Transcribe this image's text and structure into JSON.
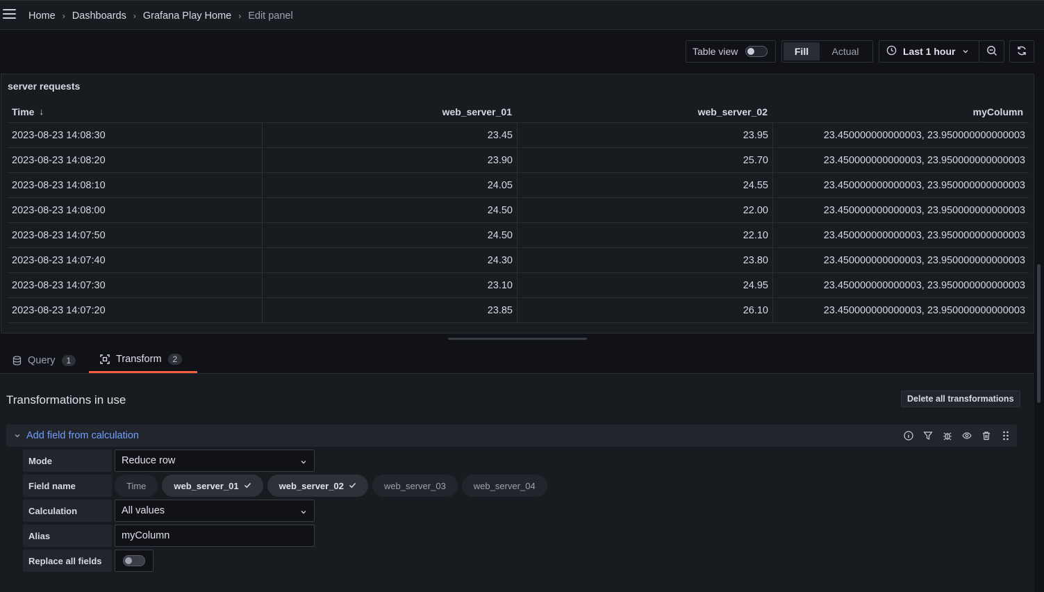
{
  "breadcrumb": {
    "items": [
      "Home",
      "Dashboards",
      "Grafana Play Home"
    ],
    "current": "Edit panel",
    "separator": "›"
  },
  "toolbar": {
    "table_view_label": "Table view",
    "table_view_on": false,
    "fill_label": "Fill",
    "actual_label": "Actual",
    "time_range": "Last 1 hour"
  },
  "panel": {
    "title": "server requests",
    "columns": [
      "Time",
      "web_server_01",
      "web_server_02",
      "myColumn"
    ],
    "sort_indicator": "↓",
    "rows": [
      [
        "2023-08-23 14:08:30",
        "23.45",
        "23.95",
        "23.450000000000003, 23.950000000000003"
      ],
      [
        "2023-08-23 14:08:20",
        "23.90",
        "25.70",
        "23.450000000000003, 23.950000000000003"
      ],
      [
        "2023-08-23 14:08:10",
        "24.05",
        "24.55",
        "23.450000000000003, 23.950000000000003"
      ],
      [
        "2023-08-23 14:08:00",
        "24.50",
        "22.00",
        "23.450000000000003, 23.950000000000003"
      ],
      [
        "2023-08-23 14:07:50",
        "24.50",
        "22.10",
        "23.450000000000003, 23.950000000000003"
      ],
      [
        "2023-08-23 14:07:40",
        "24.30",
        "23.80",
        "23.450000000000003, 23.950000000000003"
      ],
      [
        "2023-08-23 14:07:30",
        "23.10",
        "24.95",
        "23.450000000000003, 23.950000000000003"
      ],
      [
        "2023-08-23 14:07:20",
        "23.85",
        "26.10",
        "23.450000000000003, 23.950000000000003"
      ]
    ]
  },
  "tabs": [
    {
      "label": "Query",
      "count": "1",
      "icon": "database-icon"
    },
    {
      "label": "Transform",
      "count": "2",
      "icon": "transform-icon",
      "active": true
    }
  ],
  "transformations": {
    "title": "Transformations in use",
    "delete_all_label": "Delete all transformations",
    "item": {
      "name": "Add field from calculation",
      "mode_label": "Mode",
      "mode_value": "Reduce row",
      "field_name_label": "Field name",
      "fields": [
        {
          "name": "Time",
          "selected": false
        },
        {
          "name": "web_server_01",
          "selected": true
        },
        {
          "name": "web_server_02",
          "selected": true
        },
        {
          "name": "web_server_03",
          "selected": false
        },
        {
          "name": "web_server_04",
          "selected": false
        }
      ],
      "calculation_label": "Calculation",
      "calculation_value": "All values",
      "alias_label": "Alias",
      "alias_value": "myColumn",
      "replace_label": "Replace all fields",
      "replace_on": false
    }
  },
  "colors": {
    "accent": "#f55f3e",
    "link": "#6e9fff",
    "background": "#111217",
    "panel": "#181b1f"
  }
}
